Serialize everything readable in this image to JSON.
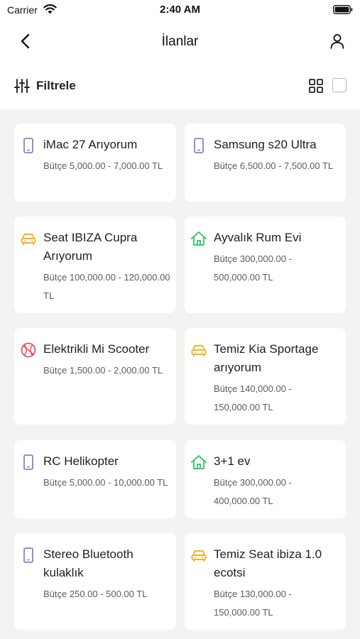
{
  "status_bar": {
    "carrier": "Carrier",
    "time": "2:40 AM"
  },
  "nav": {
    "title": "İlanlar",
    "back_icon": "chevron-left-icon",
    "profile_icon": "user-icon"
  },
  "toolbar": {
    "filter_label": "Filtrele",
    "filter_icon": "sliders-icon",
    "grid_icon": "grid-icon",
    "list_icon": "square-icon"
  },
  "colors": {
    "background": "#f3f4f1",
    "card": "#ffffff",
    "phone_icon": "#8b7fd6",
    "car_icon": "#f0b429",
    "home_icon": "#3cc878",
    "sport_icon": "#e8506a"
  },
  "listings": [
    {
      "title": "iMac 27 Arıyorum",
      "budget": "Bütçe 5,000.00 - 7,000.00 TL",
      "icon": "phone-icon"
    },
    {
      "title": "Samsung s20 Ultra",
      "budget": "Bütçe 6,500.00 - 7,500.00 TL",
      "icon": "phone-icon"
    },
    {
      "title": "Seat IBIZA Cupra Arıyorum",
      "budget": "Bütçe 100,000.00 - 120,000.00 TL",
      "icon": "car-icon"
    },
    {
      "title": "Ayvalık Rum Evi",
      "budget": "Bütçe 300,000.00 - 500,000.00 TL",
      "icon": "home-icon"
    },
    {
      "title": "Elektrikli Mi Scooter",
      "budget": "Bütçe 1,500.00 - 2,000.00 TL",
      "icon": "ball-icon"
    },
    {
      "title": "Temiz Kia Sportage arıyorum",
      "budget": "Bütçe 140,000.00 - 150,000.00 TL",
      "icon": "car-icon"
    },
    {
      "title": "RC Helikopter",
      "budget": "Bütçe 5,000.00 - 10,000.00 TL",
      "icon": "phone-icon"
    },
    {
      "title": "3+1 ev",
      "budget": "Bütçe 300,000.00 - 400,000.00 TL",
      "icon": "home-icon"
    },
    {
      "title": "Stereo Bluetooth kulaklık",
      "budget": "Bütçe 250.00 - 500.00 TL",
      "icon": "phone-icon"
    },
    {
      "title": "Temiz Seat ibiza 1.0 ecotsi",
      "budget": "Bütçe 130,000.00 - 150,000.00 TL",
      "icon": "car-icon"
    }
  ]
}
